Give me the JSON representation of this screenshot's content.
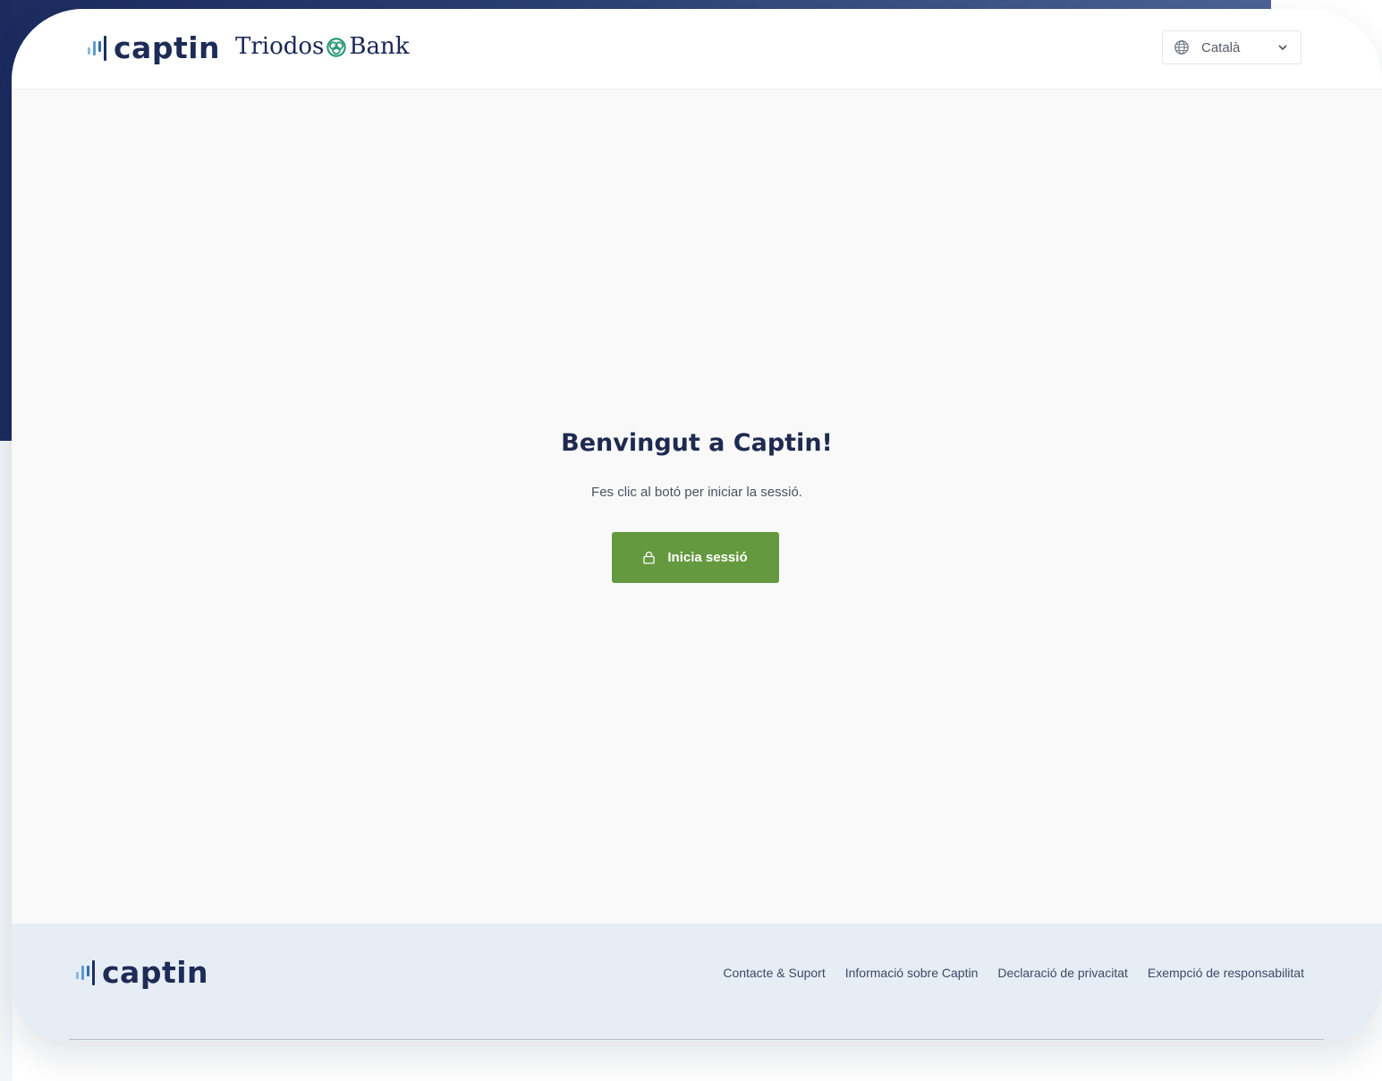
{
  "header": {
    "brand": "captin",
    "partner_brand_left": "Triodos",
    "partner_brand_right": "Bank",
    "language": {
      "selected": "Català",
      "icon": "globe-icon",
      "dropdown_icon": "chevron-down-icon"
    }
  },
  "main": {
    "title": "Benvingut a Captin!",
    "subtitle": "Fes clic al botó per iniciar la sessió.",
    "login_button": {
      "label": "Inicia sessió",
      "icon": "lock-icon"
    }
  },
  "footer": {
    "brand": "captin",
    "links": [
      "Contacte & Suport",
      "Informació sobre Captin",
      "Declaració de privacitat",
      "Exempció de responsabilitat"
    ]
  },
  "colors": {
    "primary_button": "#65993f",
    "brand_navy": "#1d2c57",
    "footer_bg": "#e6edf5",
    "page_bg": "#f9f9fa"
  }
}
